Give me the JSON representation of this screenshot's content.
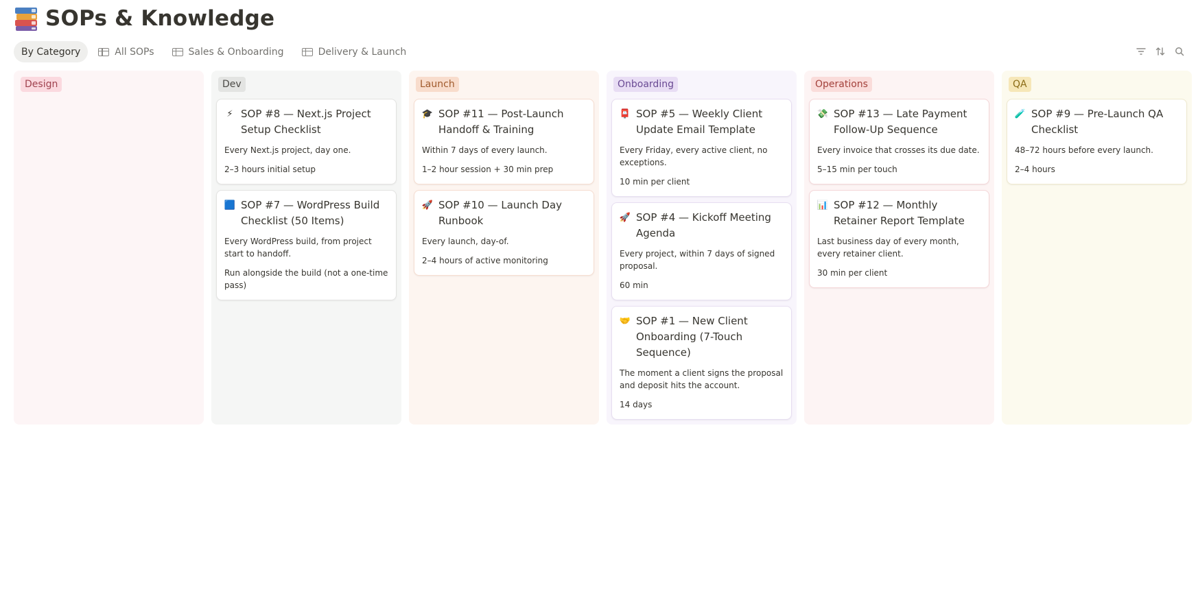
{
  "page": {
    "title": "SOPs & Knowledge",
    "icon": "books-icon"
  },
  "tabs": [
    {
      "label": "By Category",
      "icon": "board-view-icon",
      "active": true
    },
    {
      "label": "All SOPs",
      "icon": "table-view-icon",
      "active": false
    },
    {
      "label": "Sales & Onboarding",
      "icon": "table-view-icon",
      "active": false
    },
    {
      "label": "Delivery & Launch",
      "icon": "table-view-icon",
      "active": false
    }
  ],
  "toolbar": [
    "filter-icon",
    "sort-icon",
    "search-icon"
  ],
  "columns": [
    {
      "name": "Design",
      "colors": {
        "bg": "#fdf5f6",
        "tag": "#fbd9df",
        "tagText": "#a0424f",
        "cardBorder": "#f2d4d9"
      },
      "cards": []
    },
    {
      "name": "Dev",
      "colors": {
        "bg": "#f5f6f5",
        "tag": "#e3e4e2",
        "tagText": "#4b4a46",
        "cardBorder": "#e3e3e1"
      },
      "cards": [
        {
          "emoji": "⚡",
          "title": "SOP #8 — Next.js Project Setup Checklist",
          "desc": "Every Next.js project, day one.",
          "time": "2–3 hours initial setup"
        },
        {
          "emoji": "🟦",
          "title": "SOP #7 — WordPress Build Checklist (50 Items)",
          "desc": "Every WordPress build, from project start to handoff.",
          "time": "Run alongside the build (not a one-time pass)"
        }
      ]
    },
    {
      "name": "Launch",
      "colors": {
        "bg": "#fdf5f0",
        "tag": "#f8dccc",
        "tagText": "#a05a2c",
        "cardBorder": "#f6ddd0"
      },
      "cards": [
        {
          "emoji": "🎓",
          "title": "SOP #11 — Post-Launch Handoff & Training",
          "desc": "Within 7 days of every launch.",
          "time": "1–2 hour session + 30 min prep"
        },
        {
          "emoji": "🚀",
          "title": "SOP #10 — Launch Day Runbook",
          "desc": "Every launch, day-of.",
          "time": "2–4 hours of active monitoring"
        }
      ]
    },
    {
      "name": "Onboarding",
      "colors": {
        "bg": "#f8f5fc",
        "tag": "#e8ddf4",
        "tagText": "#6a4a94",
        "cardBorder": "#e7def1"
      },
      "cards": [
        {
          "emoji": "📮",
          "title": "SOP #5 — Weekly Client Update Email Template",
          "desc": "Every Friday, every active client, no exceptions.",
          "time": "10 min per client"
        },
        {
          "emoji": "🚀",
          "title": "SOP #4 — Kickoff Meeting Agenda",
          "desc": "Every project, within 7 days of signed proposal.",
          "time": "60 min"
        },
        {
          "emoji": "🤝",
          "title": "SOP #1 — New Client Onboarding (7-Touch Sequence)",
          "desc": "The moment a client signs the proposal and deposit hits the account.",
          "time": "14 days"
        }
      ]
    },
    {
      "name": "Operations",
      "colors": {
        "bg": "#fdf4f4",
        "tag": "#fadcda",
        "tagText": "#a3413b",
        "cardBorder": "#f4d6d8"
      },
      "cards": [
        {
          "emoji": "💸",
          "title": "SOP #13 — Late Payment Follow-Up Sequence",
          "desc": "Every invoice that crosses its due date.",
          "time": "5–15 min per touch"
        },
        {
          "emoji": "📊",
          "title": "SOP #12 — Monthly Retainer Report Template",
          "desc": "Last business day of every month, every retainer client.",
          "time": "30 min per client"
        }
      ]
    },
    {
      "name": "QA",
      "colors": {
        "bg": "#fcfaee",
        "tag": "#f6e7b8",
        "tagText": "#8a6a15",
        "cardBorder": "#efe9cf"
      },
      "cards": [
        {
          "emoji": "🧪",
          "title": "SOP #9 — Pre-Launch QA Checklist",
          "desc": "48–72 hours before every launch.",
          "time": "2–4 hours"
        }
      ]
    }
  ]
}
